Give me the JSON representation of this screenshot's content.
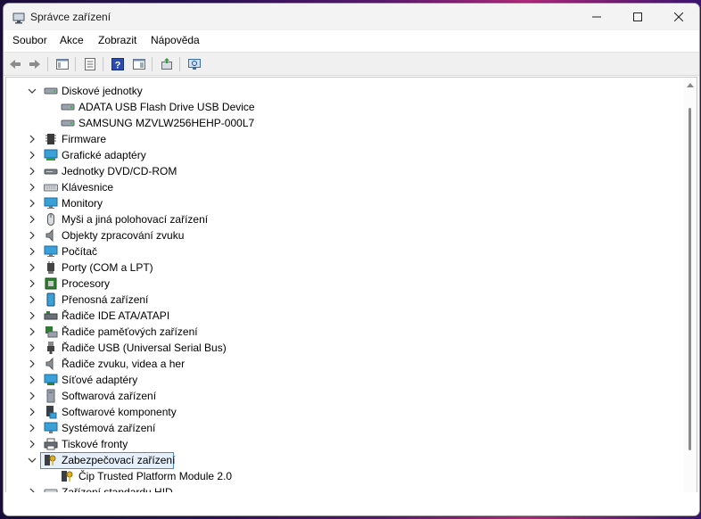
{
  "window": {
    "title": "Správce zařízení"
  },
  "menu": {
    "items": [
      "Soubor",
      "Akce",
      "Zobrazit",
      "Nápověda"
    ]
  },
  "toolbar": {
    "buttons": [
      "back-arrow-icon",
      "forward-arrow-icon",
      "show-hide-tree-icon",
      "properties-icon",
      "help-icon",
      "details-view-icon",
      "update-driver-icon",
      "scan-hardware-icon"
    ]
  },
  "tree": {
    "items": [
      {
        "label": "Diskové jednotky",
        "level": 0,
        "expanded": true,
        "icon": "disk-drive-icon"
      },
      {
        "label": "ADATA USB Flash Drive USB Device",
        "level": 1,
        "icon": "disk-drive-icon"
      },
      {
        "label": "SAMSUNG MZVLW256HEHP-000L7",
        "level": 1,
        "icon": "disk-drive-icon"
      },
      {
        "label": "Firmware",
        "level": 0,
        "expanded": false,
        "icon": "firmware-icon"
      },
      {
        "label": "Grafické adaptéry",
        "level": 0,
        "expanded": false,
        "icon": "display-adapter-icon"
      },
      {
        "label": "Jednotky DVD/CD-ROM",
        "level": 0,
        "expanded": false,
        "icon": "dvd-drive-icon"
      },
      {
        "label": "Klávesnice",
        "level": 0,
        "expanded": false,
        "icon": "keyboard-icon"
      },
      {
        "label": "Monitory",
        "level": 0,
        "expanded": false,
        "icon": "monitor-icon"
      },
      {
        "label": "Myši a jiná polohovací zařízení",
        "level": 0,
        "expanded": false,
        "icon": "mouse-icon"
      },
      {
        "label": "Objekty zpracování zvuku",
        "level": 0,
        "expanded": false,
        "icon": "speaker-icon"
      },
      {
        "label": "Počítač",
        "level": 0,
        "expanded": false,
        "icon": "computer-icon"
      },
      {
        "label": "Porty (COM a LPT)",
        "level": 0,
        "expanded": false,
        "icon": "port-icon"
      },
      {
        "label": "Procesory",
        "level": 0,
        "expanded": false,
        "icon": "processor-icon"
      },
      {
        "label": "Přenosná zařízení",
        "level": 0,
        "expanded": false,
        "icon": "portable-device-icon"
      },
      {
        "label": "Řadiče IDE ATA/ATAPI",
        "level": 0,
        "expanded": false,
        "icon": "ide-controller-icon"
      },
      {
        "label": "Řadiče paměťových zařízení",
        "level": 0,
        "expanded": false,
        "icon": "storage-controller-icon"
      },
      {
        "label": "Řadiče USB (Universal Serial Bus)",
        "level": 0,
        "expanded": false,
        "icon": "usb-icon"
      },
      {
        "label": "Řadiče zvuku, videa a her",
        "level": 0,
        "expanded": false,
        "icon": "speaker-icon"
      },
      {
        "label": "Síťové adaptéry",
        "level": 0,
        "expanded": false,
        "icon": "network-adapter-icon"
      },
      {
        "label": "Softwarová zařízení",
        "level": 0,
        "expanded": false,
        "icon": "software-device-icon"
      },
      {
        "label": "Softwarové komponenty",
        "level": 0,
        "expanded": false,
        "icon": "software-component-icon"
      },
      {
        "label": "Systémová zařízení",
        "level": 0,
        "expanded": false,
        "icon": "system-device-icon"
      },
      {
        "label": "Tiskové fronty",
        "level": 0,
        "expanded": false,
        "icon": "printer-icon"
      },
      {
        "label": "Zabezpečovací zařízení",
        "level": 0,
        "expanded": true,
        "selected": true,
        "icon": "security-device-icon"
      },
      {
        "label": "Čip Trusted Platform Module 2.0",
        "level": 1,
        "icon": "security-device-icon"
      },
      {
        "label": "Zařízení standardu HID",
        "level": 0,
        "expanded": false,
        "icon": "hid-icon"
      }
    ]
  },
  "colors": {
    "selection_border": "#4a89d9",
    "selection_fill": "#e5f0fb",
    "titlebar": "#f3f3f3"
  }
}
